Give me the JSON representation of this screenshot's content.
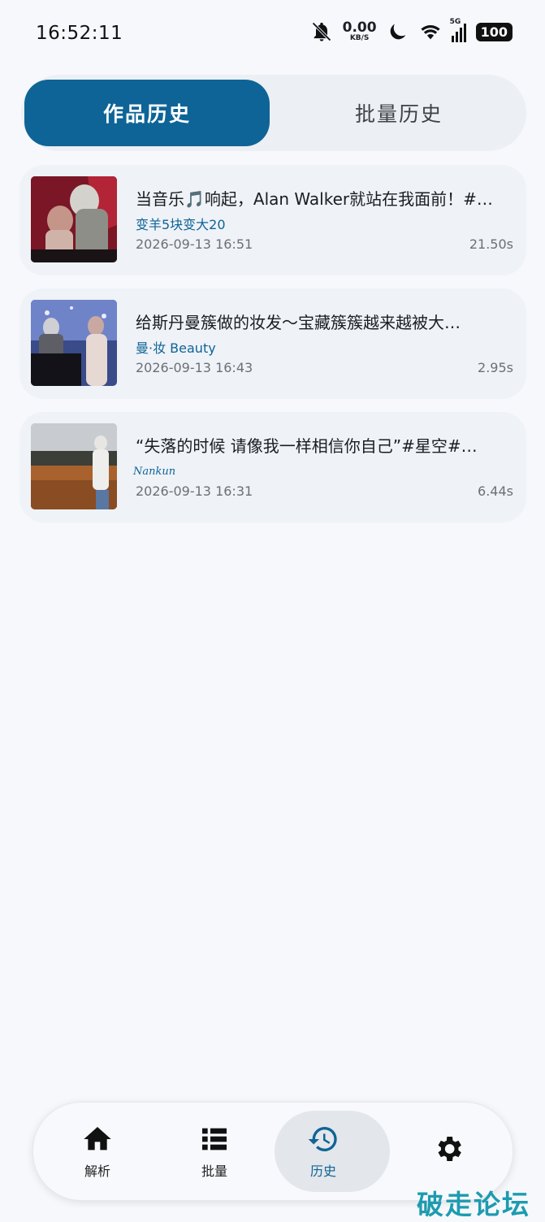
{
  "status_bar": {
    "time": "16:52:11",
    "net_speed_value": "0.00",
    "net_speed_unit": "KB/S",
    "signal_label": "5G",
    "battery": "100",
    "icons": [
      "bell-off-icon",
      "moon-icon",
      "wifi-icon",
      "signal-icon",
      "battery-icon"
    ]
  },
  "tabs": [
    {
      "label": "作品历史",
      "active": true
    },
    {
      "label": "批量历史",
      "active": false
    }
  ],
  "history": [
    {
      "title": "当音乐🎵响起，Alan Walker就站在我面前！#…",
      "author": "变羊5块变大20",
      "date": "2026-09-13 16:51",
      "duration": "21.50s"
    },
    {
      "title": "给斯丹曼簇做的妆发～宝藏簇簇越来越被大…",
      "author": "曼·妆 Beauty",
      "date": "2026-09-13 16:43",
      "duration": "2.95s"
    },
    {
      "title": "“失落的时候 请像我一样相信你自己”#星空#…",
      "author": "Nankun",
      "date": "2026-09-13 16:31",
      "duration": "6.44s"
    }
  ],
  "nav": [
    {
      "label": "解析",
      "icon": "home-icon"
    },
    {
      "label": "批量",
      "icon": "list-icon"
    },
    {
      "label": "历史",
      "icon": "history-icon",
      "active": true
    },
    {
      "label": "",
      "icon": "gear-icon"
    }
  ],
  "colors": {
    "accent": "#0e6497",
    "background": "#f6f8fc",
    "card": "#eff2f7"
  },
  "watermark": "破走论坛"
}
